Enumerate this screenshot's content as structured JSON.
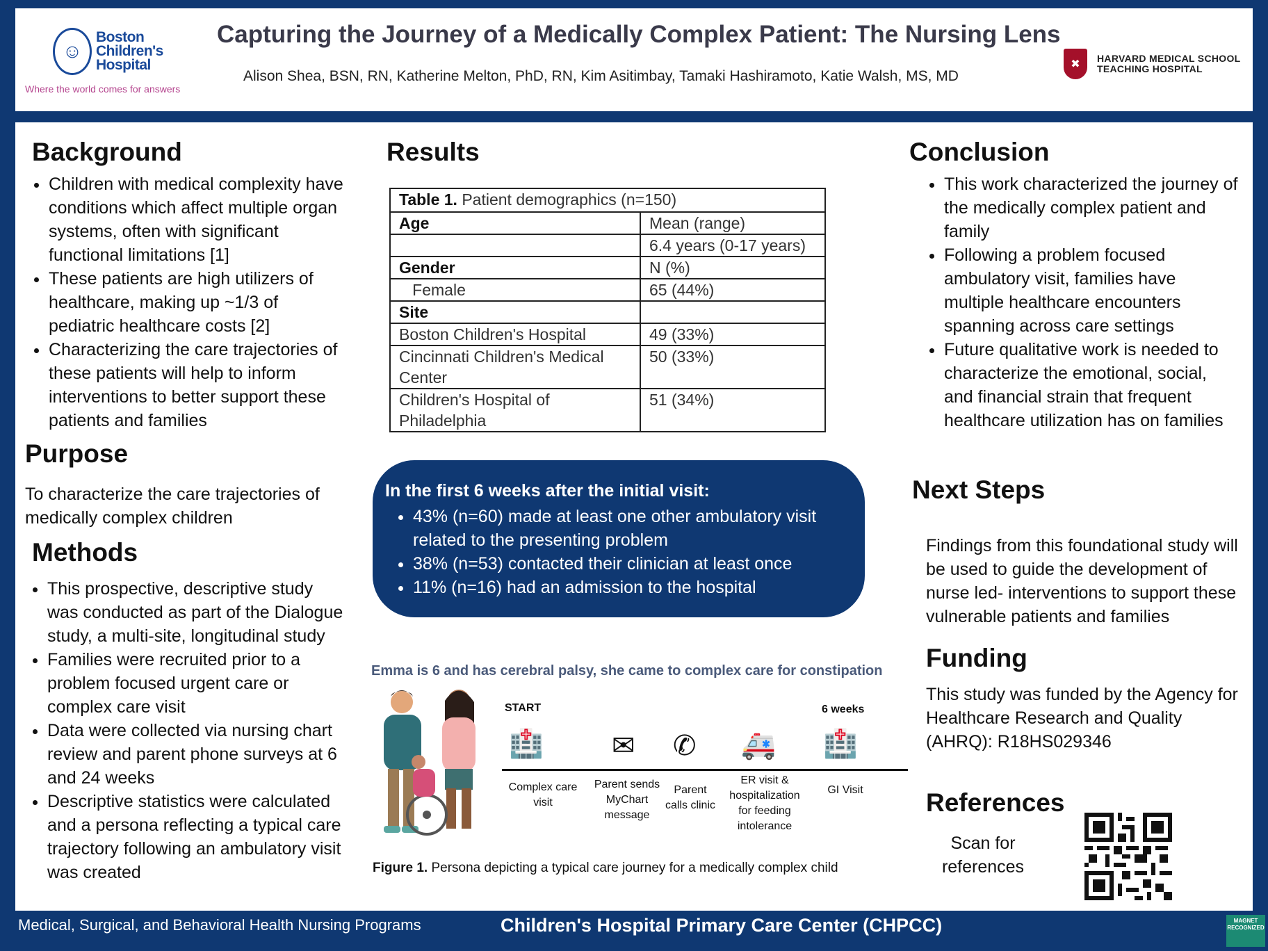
{
  "header": {
    "title": "Capturing the Journey of a Medically Complex Patient: The Nursing Lens",
    "authors": "Alison Shea, BSN, RN, Katherine Melton, PhD, RN, Kim Asitimbay, Tamaki Hashiramoto, Katie Walsh, MS, MD",
    "left_logo": {
      "line1": "Boston",
      "line2": "Children's",
      "line3": "Hospital",
      "tagline": "Where the world comes for answers"
    },
    "right_logo": {
      "line1": "HARVARD MEDICAL SCHOOL",
      "line2": "TEACHING HOSPITAL"
    }
  },
  "background": {
    "heading": "Background",
    "bullets": [
      "Children with medical complexity have conditions which affect multiple organ systems, often with significant functional limitations [1]",
      "These patients are high utilizers of healthcare, making up ~1/3 of pediatric healthcare costs [2]",
      "Characterizing the care trajectories of these patients will help to inform interventions to better support these patients and families"
    ]
  },
  "purpose": {
    "heading": "Purpose",
    "text": "To characterize the care trajectories of medically complex children"
  },
  "methods": {
    "heading": "Methods",
    "bullets": [
      "This prospective, descriptive study was conducted as part of the Dialogue study, a multi-site, longitudinal study",
      "Families were recruited prior to a problem focused urgent care or complex care visit",
      "Data were collected via nursing chart review and parent phone surveys at 6 and 24 weeks",
      " Descriptive statistics were calculated and a persona reflecting a typical care trajectory following an ambulatory visit was created"
    ]
  },
  "results": {
    "heading": "Results",
    "table": {
      "caption_bold": "Table 1.",
      "caption": " Patient demographics (n=150)",
      "rows": [
        {
          "c1": "Age",
          "c2": "Mean (range)"
        },
        {
          "c1": "",
          "c2": "6.4 years (0-17 years)"
        },
        {
          "c1": "Gender",
          "c2": "N (%)"
        },
        {
          "c1": "   Female",
          "c2": "65 (44%)"
        },
        {
          "c1": "Site",
          "c2": ""
        },
        {
          "c1": "Boston Children's Hospital",
          "c2": "49 (33%)"
        },
        {
          "c1": "Cincinnati Children's Medical Center",
          "c2": "50 (33%)"
        },
        {
          "c1": "Children's Hospital of Philadelphia",
          "c2": "51 (34%)"
        }
      ]
    },
    "highlight": {
      "heading": "In the first 6 weeks after the initial visit:",
      "bullets": [
        "43% (n=60) made at least one other ambulatory visit related to the presenting problem",
        "38% (n=53) contacted their clinician at least once",
        "11% (n=16) had an admission to the hospital"
      ]
    },
    "persona": {
      "caption": "Emma is 6 and has cerebral palsy, she came to complex care for constipation",
      "start_label": "START",
      "end_label": "6 weeks",
      "steps": [
        {
          "icon": "hospital-icon",
          "label": "Complex care visit"
        },
        {
          "icon": "envelope-icon",
          "label": "Parent sends MyChart message"
        },
        {
          "icon": "phone-icon",
          "label": "Parent calls clinic"
        },
        {
          "icon": "ambulance-icon",
          "label": "ER visit & hospitalization for feeding intolerance"
        },
        {
          "icon": "hospital-icon",
          "label": "GI Visit"
        }
      ]
    },
    "figure_caption_bold": "Figure 1.",
    "figure_caption": " Persona depicting a typical care journey for a medically complex child"
  },
  "conclusion": {
    "heading": "Conclusion",
    "bullets": [
      "This work characterized the journey of the medically complex patient and family",
      "Following a problem focused ambulatory visit, families have multiple healthcare encounters spanning across care settings",
      "Future qualitative work is needed to characterize the emotional, social, and financial strain that frequent healthcare utilization has on families"
    ]
  },
  "next_steps": {
    "heading": "Next Steps",
    "text": "Findings from this foundational study will be used to guide the development of nurse led- interventions to support these vulnerable patients and families"
  },
  "funding": {
    "heading": "Funding",
    "text": "This study was funded by the Agency for Healthcare Research and Quality (AHRQ): R18HS029346"
  },
  "references": {
    "heading": "References",
    "text": "Scan for references"
  },
  "footer": {
    "left": "Medical, Surgical, and Behavioral Health Nursing Programs",
    "center": "Children's Hospital Primary Care Center (CHPCC)",
    "badge": "MAGNET RECOGNIZED"
  },
  "colors": {
    "navy": "#0f3872",
    "tagline": "#b5468f",
    "harvard_red": "#a4102a"
  }
}
